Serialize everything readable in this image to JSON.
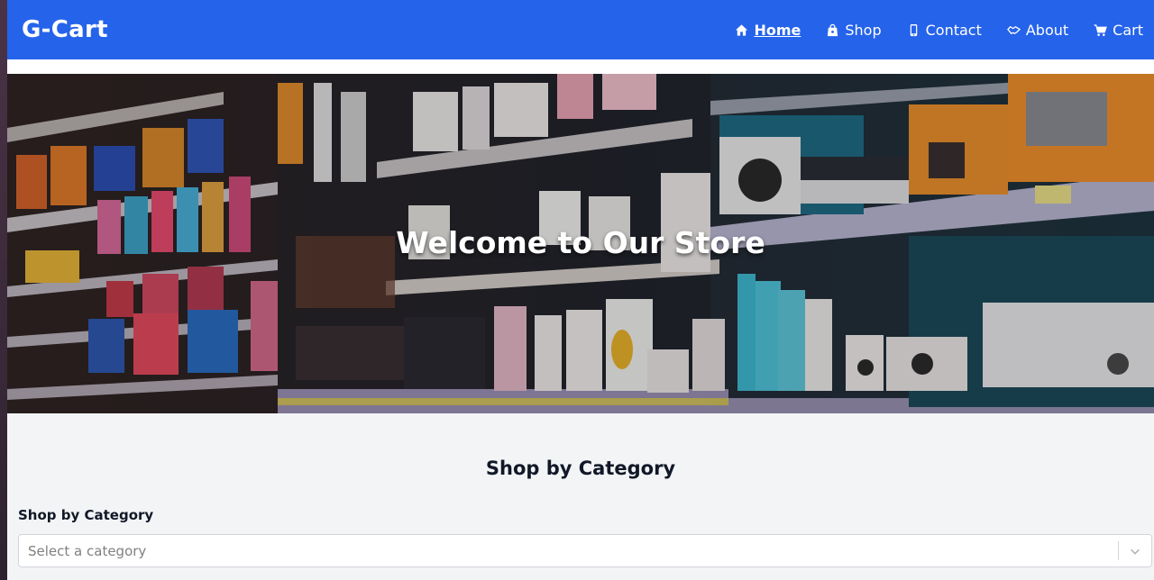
{
  "navbar": {
    "brand": "G-Cart",
    "links": [
      {
        "label": "Home",
        "icon": "home-icon",
        "active": true
      },
      {
        "label": "Shop",
        "icon": "shopping-bag-icon",
        "active": false
      },
      {
        "label": "Contact",
        "icon": "phone-icon",
        "active": false
      },
      {
        "label": "About",
        "icon": "handshake-icon",
        "active": false
      },
      {
        "label": "Cart",
        "icon": "cart-icon",
        "active": false
      }
    ]
  },
  "hero": {
    "title": "Welcome to Our Store"
  },
  "category_section": {
    "title": "Shop by Category",
    "field_label": "Shop by Category",
    "select_placeholder": "Select a category"
  },
  "colors": {
    "navbar": "#2563eb",
    "page_background": "#f3f4f6",
    "text_dark": "#111827"
  }
}
